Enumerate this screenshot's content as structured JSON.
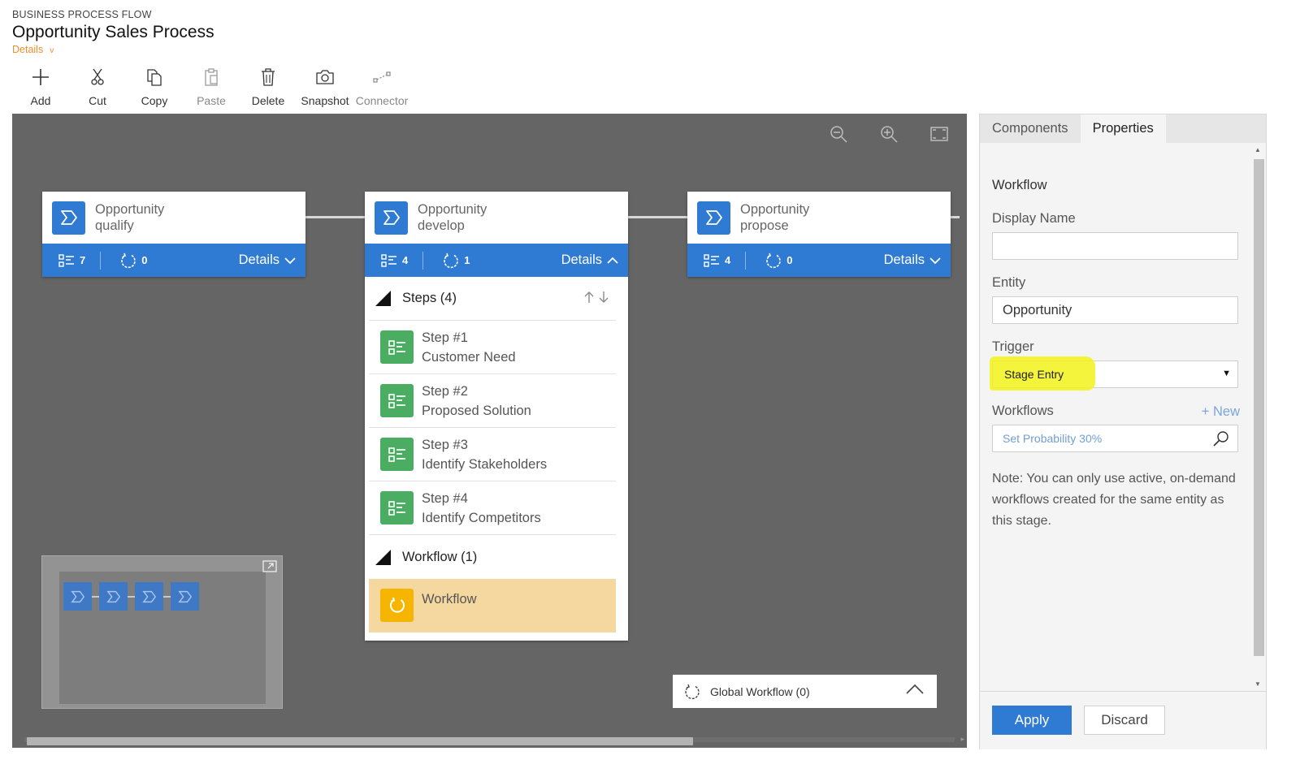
{
  "header": {
    "kicker": "BUSINESS PROCESS FLOW",
    "title": "Opportunity Sales Process",
    "details_label": "Details"
  },
  "toolbar": {
    "add": "Add",
    "cut": "Cut",
    "copy": "Copy",
    "paste": "Paste",
    "delete": "Delete",
    "snapshot": "Snapshot",
    "connector": "Connector"
  },
  "stages": [
    {
      "line1": "Opportunity",
      "line2": "qualify",
      "steps_count": "7",
      "workflow_count": "0",
      "details": "Details"
    },
    {
      "line1": "Opportunity",
      "line2": "develop",
      "steps_count": "4",
      "workflow_count": "1",
      "details": "Details"
    },
    {
      "line1": "Opportunity",
      "line2": "propose",
      "steps_count": "4",
      "workflow_count": "0",
      "details": "Details"
    }
  ],
  "expanded_stage": {
    "steps_header": "Steps (4)",
    "steps": [
      {
        "title": "Step #1",
        "name": "Customer Need"
      },
      {
        "title": "Step #2",
        "name": "Proposed Solution"
      },
      {
        "title": "Step #3",
        "name": "Identify Stakeholders"
      },
      {
        "title": "Step #4",
        "name": "Identify Competitors"
      }
    ],
    "workflow_header": "Workflow (1)",
    "workflow_item": "Workflow"
  },
  "global_workflow": "Global Workflow (0)",
  "panel": {
    "tabs": [
      "Components",
      "Properties"
    ],
    "active_tab": "Properties",
    "section_title": "Workflow",
    "display_name_label": "Display Name",
    "display_name_value": "",
    "entity_label": "Entity",
    "entity_value": "Opportunity",
    "trigger_label": "Trigger",
    "trigger_value": "Stage Entry",
    "workflows_label": "Workflows",
    "new_link": "+ New",
    "workflow_lookup_value": "Set Probability 30%",
    "note": "Note: You can only use active, on-demand workflows created for the same entity as this stage.",
    "apply": "Apply",
    "discard": "Discard"
  },
  "colors": {
    "stage_blue": "#2f7bd3",
    "step_green": "#4aad62",
    "workflow_yellow": "#f6b500",
    "workflow_highlight": "#f5d8a0",
    "canvas": "#656565",
    "details_orange": "#e8912d"
  }
}
